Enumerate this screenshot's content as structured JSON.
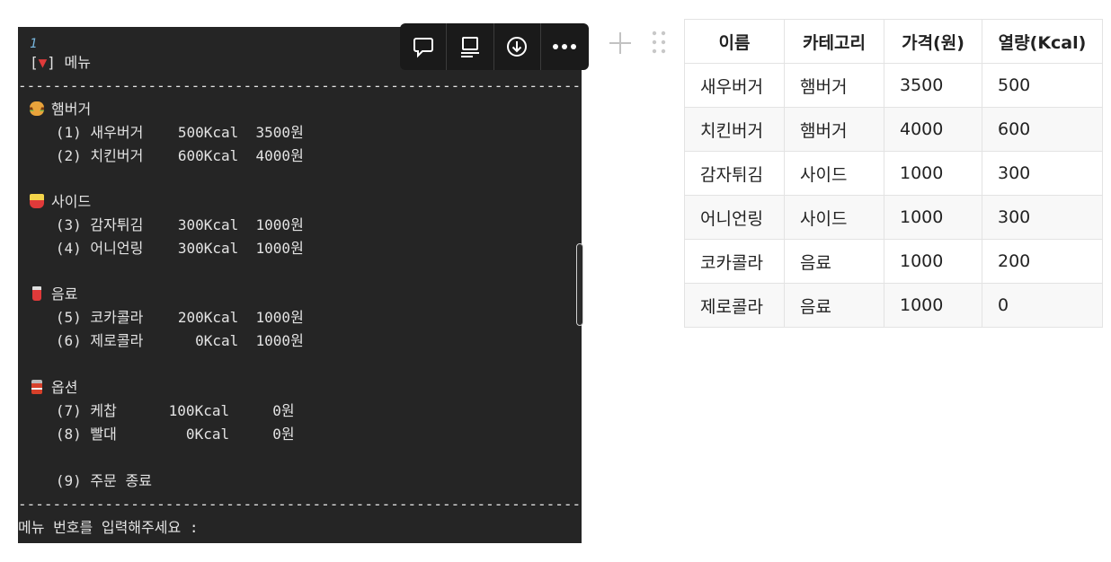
{
  "code": {
    "line_number": "1",
    "header_prefix": "[",
    "header_triangle": "▼",
    "header_suffix": "] 메뉴",
    "divider": "-------------------------------------------------------------------------------",
    "sections": [
      {
        "icon": "hamburger-icon",
        "title": "햄버거",
        "items": [
          "   (1) 새우버거    500Kcal  3500원",
          "   (2) 치킨버거    600Kcal  4000원"
        ]
      },
      {
        "icon": "fries-icon",
        "title": "사이드",
        "items": [
          "   (3) 감자튀김    300Kcal  1000원",
          "   (4) 어니언링    300Kcal  1000원"
        ]
      },
      {
        "icon": "drink-icon",
        "title": "음료",
        "items": [
          "   (5) 코카콜라    200Kcal  1000원",
          "   (6) 제로콜라      0Kcal  1000원"
        ]
      },
      {
        "icon": "sauce-jar-icon",
        "title": "옵션",
        "items": [
          "   (7) 케찹      100Kcal     0원",
          "   (8) 빨대        0Kcal     0원"
        ]
      }
    ],
    "exit_item": "   (9) 주문 종료",
    "prompt": "메뉴 번호를 입력해주세요 :"
  },
  "toolbar": {
    "buttons": [
      "comment-icon",
      "caption-icon",
      "download-icon",
      "more-icon"
    ]
  },
  "table": {
    "headers": [
      "이름",
      "카테고리",
      "가격(원)",
      "열량(Kcal)"
    ],
    "rows": [
      [
        "새우버거",
        "햄버거",
        "3500",
        "500"
      ],
      [
        "치킨버거",
        "햄버거",
        "4000",
        "600"
      ],
      [
        "감자튀김",
        "사이드",
        "1000",
        "300"
      ],
      [
        "어니언링",
        "사이드",
        "1000",
        "300"
      ],
      [
        "코카콜라",
        "음료",
        "1000",
        "200"
      ],
      [
        "제로콜라",
        "음료",
        "1000",
        "0"
      ]
    ]
  }
}
